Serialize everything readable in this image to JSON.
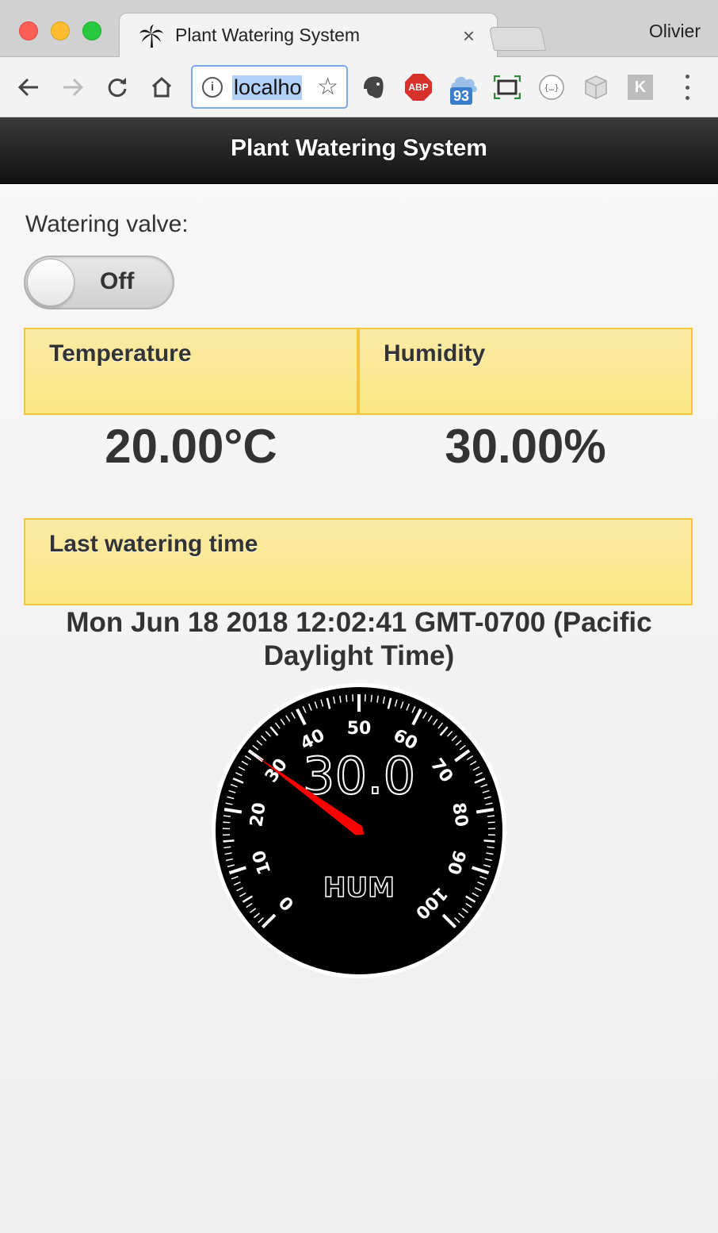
{
  "browser": {
    "tab_title": "Plant Watering System",
    "tab_close": "×",
    "profile_name": "Olivier",
    "address_text": "localhost",
    "ext_abp_label": "ABP",
    "ext_badge_count": "93",
    "ext_k_label": "K"
  },
  "header": {
    "title": "Plant Watering System"
  },
  "valve": {
    "label": "Watering valve:",
    "state": "Off"
  },
  "sensors": {
    "temperature_label": "Temperature",
    "temperature_value": "20.00°C",
    "humidity_label": "Humidity",
    "humidity_value": "30.00%"
  },
  "last_watering": {
    "label": "Last watering time",
    "value": "Mon Jun 18 2018 12:02:41 GMT-0700 (Pacific Daylight Time)"
  },
  "gauge": {
    "value": 30.0,
    "value_display": "30.0",
    "unit_label": "HUM",
    "min": 0,
    "max": 100,
    "major_ticks": [
      0,
      10,
      20,
      30,
      40,
      50,
      60,
      70,
      80,
      90,
      100
    ],
    "needle_color": "#ff0000",
    "face_color": "#000000"
  }
}
